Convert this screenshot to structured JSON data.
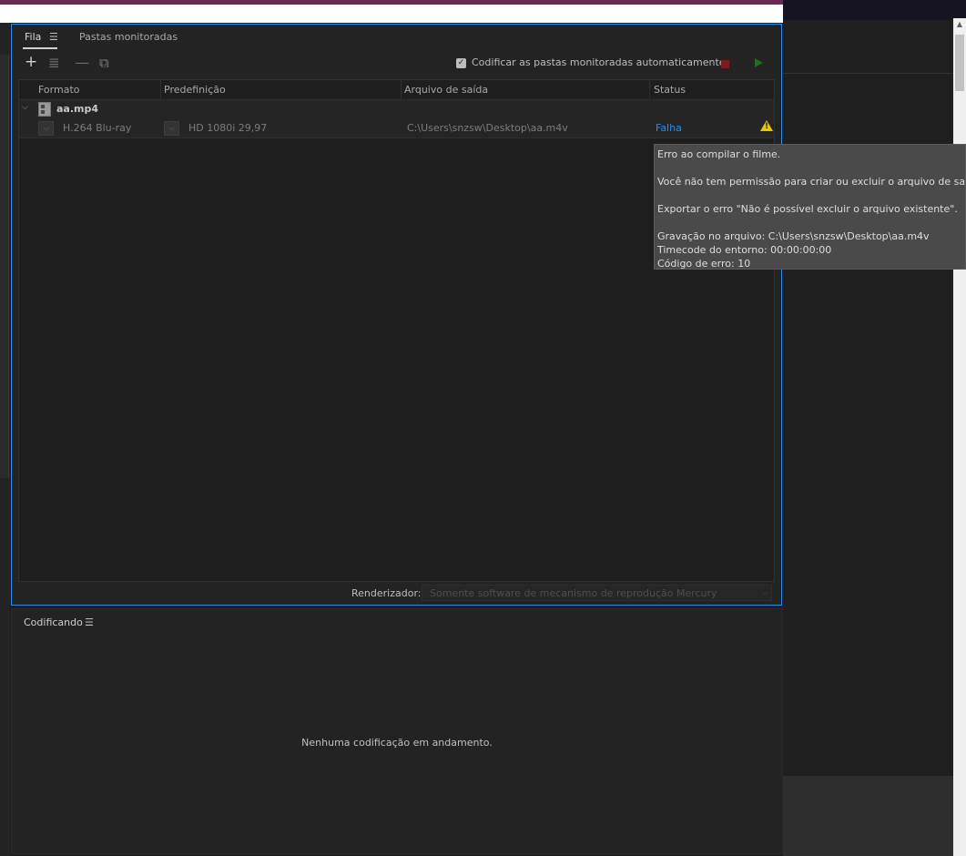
{
  "tabs": {
    "queue": "Fila",
    "menu_glyph": "☰",
    "watch_folders": "Pastas monitoradas"
  },
  "toolbar": {
    "add_icon": "+",
    "settings_icon": "≣",
    "remove_icon": "—",
    "duplicate_icon": "⧉",
    "auto_encode_label": "Codificar as pastas monitoradas automaticamente",
    "auto_encode_checked": "✓"
  },
  "table": {
    "headers": [
      "Formato",
      "Predefinição",
      "Arquivo de saída",
      "Status"
    ],
    "group": {
      "name": "aa.mp4",
      "expand_glyph": "⌵"
    },
    "item": {
      "format": "H.264 Blu-ray",
      "preset": "HD 1080i 29,97",
      "output": "C:\\Users\\snzsw\\Desktop\\aa.m4v",
      "status": "Falha",
      "dropdown_glyph": "⌵",
      "warning_glyph": "!"
    }
  },
  "renderer": {
    "label": "Renderizador:",
    "value": "Somente software de mecanismo de reprodução Mercury",
    "chevron": "⌵"
  },
  "encoding": {
    "title": "Codificando",
    "menu_glyph": "☰",
    "empty_message": "Nenhuma codificação em andamento."
  },
  "tooltip": {
    "line1": "Erro ao compilar o filme.",
    "line2": "Você não tem permissão para criar ou excluir o arquivo de saída.",
    "line3": "Exportar o erro \"Não é possível excluir o arquivo existente\".",
    "line4": "Gravação no arquivo: C:\\Users\\snzsw\\Desktop\\aa.m4v",
    "line5": "Timecode do entorno: 00:00:00:00",
    "line6": "Código de erro: 10"
  },
  "scrollbar": {
    "up_glyph": "▲"
  },
  "colors": {
    "accent": "#2d8ceb",
    "warning": "#e8c500",
    "stop": "#7a1d1d",
    "play": "#1f6e22"
  }
}
